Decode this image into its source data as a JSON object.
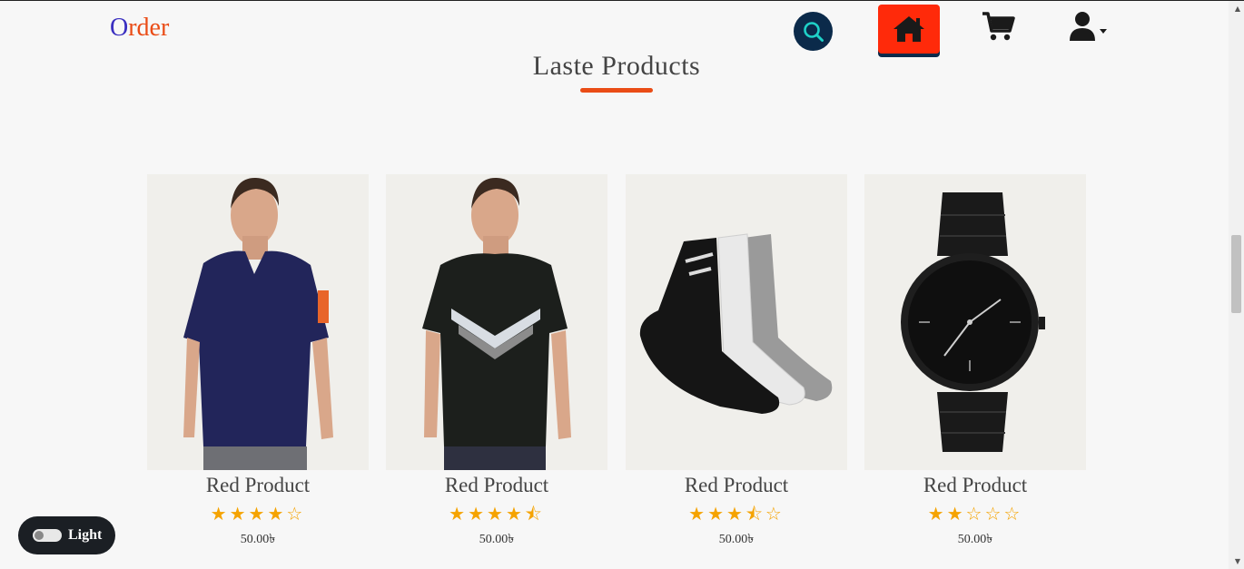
{
  "header": {
    "logo_first": "O",
    "logo_rest": "rder",
    "search_icon": "search-icon",
    "home_icon": "home-icon",
    "cart_icon": "cart-icon",
    "user_icon": "user-icon",
    "colors": {
      "accent": "#ea4c16",
      "home_bg": "#ff2a0a",
      "navy": "#0b2a4a",
      "logo_o": "#3a2fc0"
    }
  },
  "section": {
    "title": "Laste Products"
  },
  "products": [
    {
      "name": "Red Product",
      "rating": 4,
      "stars": "★★★★☆",
      "price": "50.00৳",
      "image": "navy polo t-shirt model"
    },
    {
      "name": "Red Product",
      "rating": 4.5,
      "stars": "★★★★⯪",
      "price": "50.00৳",
      "image": "black puma t-shirt model"
    },
    {
      "name": "Red Product",
      "rating": 3.5,
      "stars": "★★★⯪☆",
      "price": "50.00৳",
      "image": "socks set"
    },
    {
      "name": "Red Product",
      "rating": 2,
      "stars": "★★☆☆☆",
      "price": "50.00৳",
      "image": "black wristwatch"
    }
  ],
  "theme_toggle": {
    "label": "Light"
  }
}
